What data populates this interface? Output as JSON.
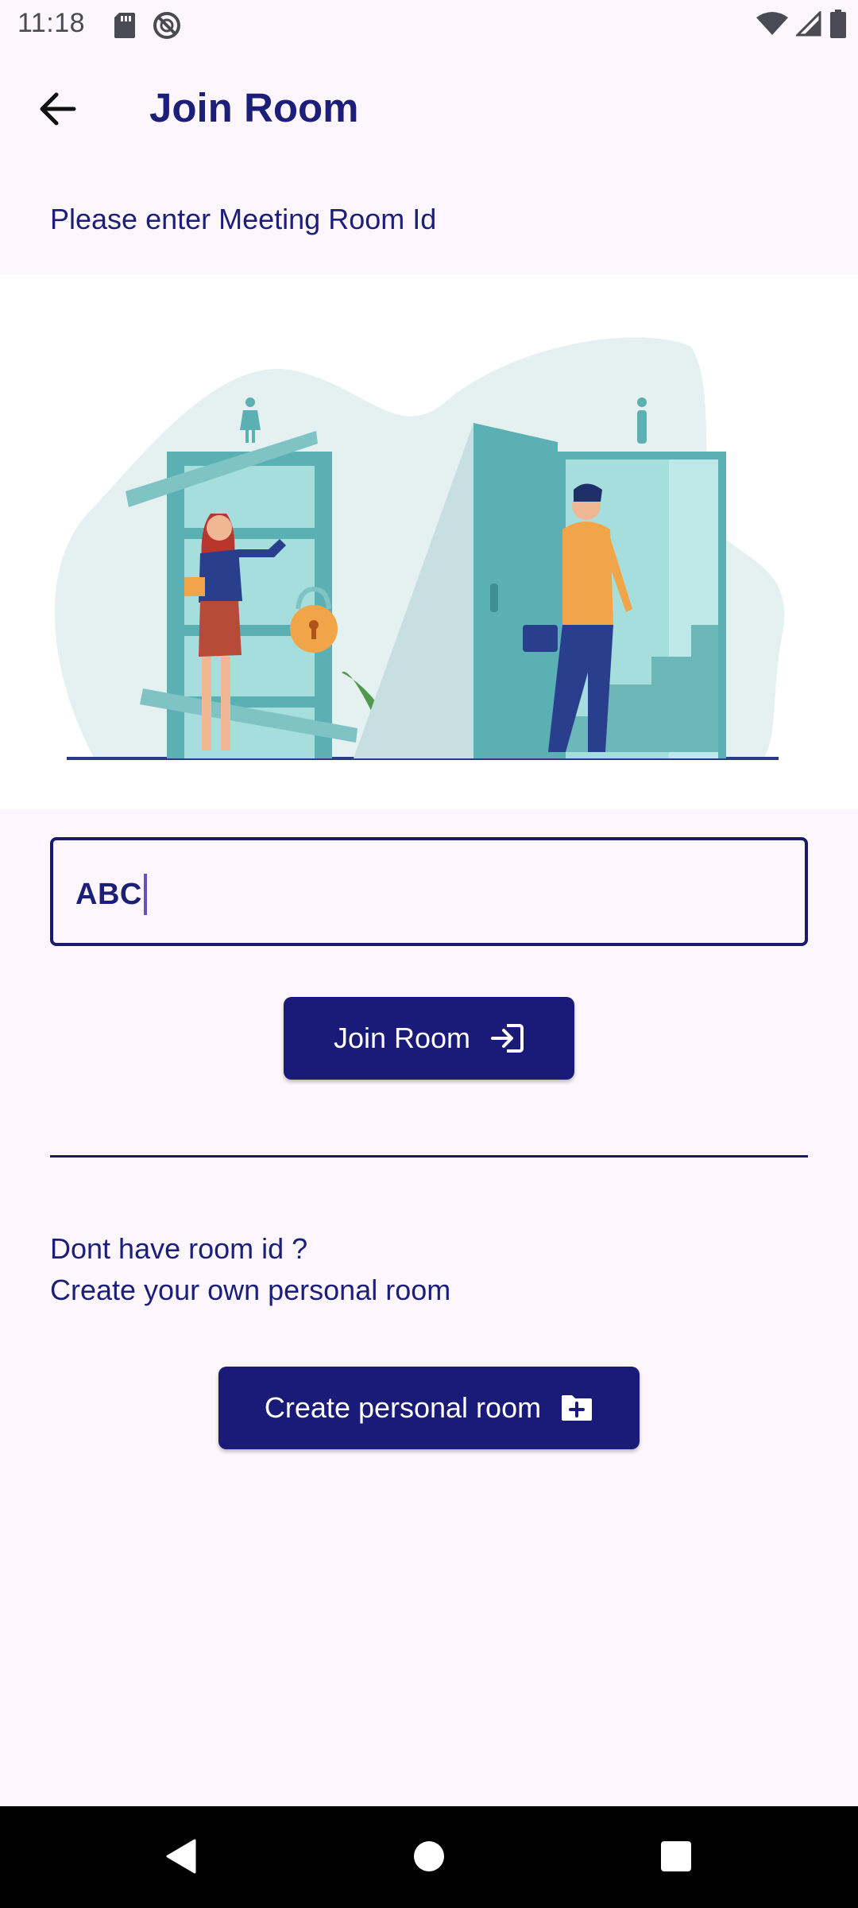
{
  "status_bar": {
    "time": "11:18",
    "left_icons": [
      "sd-card-icon",
      "do-not-disturb-icon"
    ],
    "right_icons": [
      "wifi-icon",
      "signal-icon",
      "battery-icon"
    ]
  },
  "app_bar": {
    "title": "Join Room",
    "back_icon": "arrow-back-icon"
  },
  "prompt_text": "Please enter Meeting Room Id",
  "room_input": {
    "value": "ABC"
  },
  "join_button": {
    "label": "Join Room",
    "icon": "login-icon"
  },
  "no_room": {
    "line1": "Dont have room id ?",
    "line2": "Create your own personal room"
  },
  "create_button": {
    "label": "Create personal room",
    "icon": "folder-add-icon"
  },
  "nav_bar": {
    "icons": [
      "back-triangle-icon",
      "home-circle-icon",
      "recents-square-icon"
    ]
  },
  "colors": {
    "primary": "#1a1a78",
    "background": "#fdf6fc",
    "text": "#1c1f7a"
  }
}
